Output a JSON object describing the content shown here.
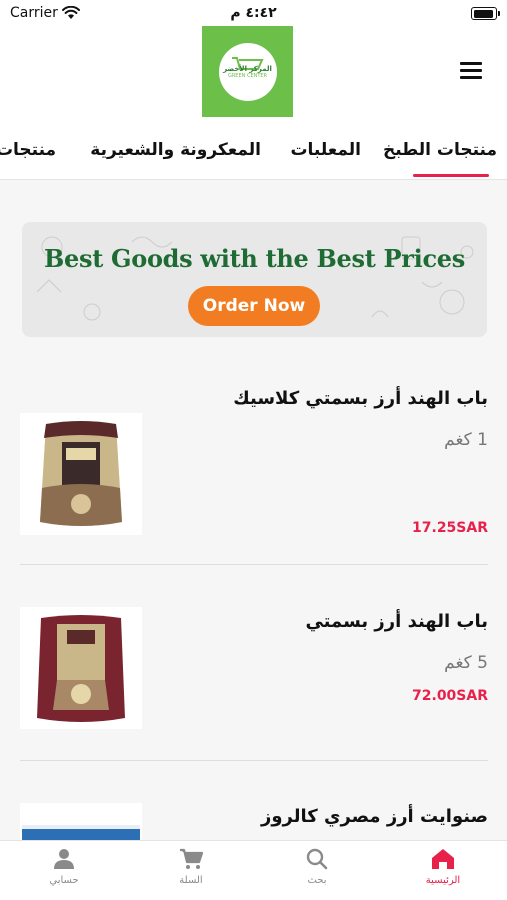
{
  "status_bar": {
    "carrier": "Carrier",
    "time": "٤:٤٢ م",
    "battery_level": 0.95
  },
  "header": {
    "logo_text_ar": "المركز الأخضر",
    "logo_text_en": "GREEN CENTER",
    "menu_icon": "menu-icon"
  },
  "tabs": [
    {
      "label": "منتجات الطبخ",
      "active": true
    },
    {
      "label": "المعلبات",
      "active": false
    },
    {
      "label": "المعكرونة والشعيرية",
      "active": false
    },
    {
      "label": "منتجات الـ",
      "active": false
    }
  ],
  "banner": {
    "title": "Best Goods with the Best Prices",
    "button_label": "Order Now",
    "title_color": "#1e6b33",
    "button_color": "#f27c22"
  },
  "products": [
    {
      "name": "باب الهند أرز بسمتي كلاسيك",
      "weight": "1 كغم",
      "price": "17.25SAR"
    },
    {
      "name": "باب الهند أرز بسمتي",
      "weight": "5 كغم",
      "price": "72.00SAR"
    },
    {
      "name": "صنوايت أرز مصري كالروز",
      "weight": "",
      "price": ""
    }
  ],
  "bottom_nav": [
    {
      "label": "الرئيسية",
      "icon": "home-icon",
      "active": true
    },
    {
      "label": "بحث",
      "icon": "search-icon",
      "active": false
    },
    {
      "label": "السلة",
      "icon": "cart-icon",
      "active": false
    },
    {
      "label": "حسابي",
      "icon": "account-icon",
      "active": false
    }
  ],
  "colors": {
    "accent": "#e8214b",
    "brand_green": "#6cc04a"
  }
}
